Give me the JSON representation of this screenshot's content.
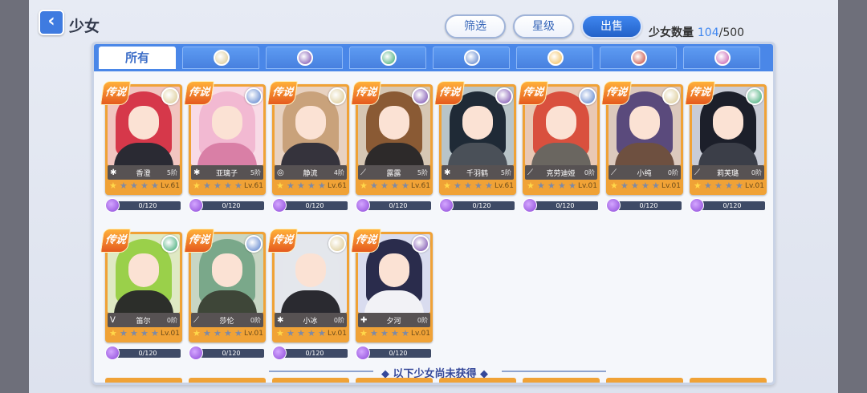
{
  "header": {
    "back_icon": "chevron-left-icon",
    "title": "少女",
    "filter_label": "筛选",
    "star_label": "星级",
    "sell_label": "出售",
    "count_label": "少女数量",
    "count_current": "104",
    "count_max": "/500"
  },
  "tabs": [
    {
      "label": "所有",
      "icon": "",
      "active": true
    },
    {
      "label": "",
      "icon": "gold-emblem-icon",
      "color": "#d8c58a"
    },
    {
      "label": "",
      "icon": "purple-emblem-icon",
      "color": "#6e3fa8"
    },
    {
      "label": "",
      "icon": "green-emblem-icon",
      "color": "#2fa36a"
    },
    {
      "label": "",
      "icon": "blue-gold-emblem-icon",
      "color": "#4d78c8"
    },
    {
      "label": "",
      "icon": "sun-emblem-icon",
      "color": "#f0b84a"
    },
    {
      "label": "",
      "icon": "red-emblem-icon",
      "color": "#c0392b"
    },
    {
      "label": "",
      "icon": "pink-emblem-icon",
      "color": "#c24fa8"
    }
  ],
  "badge_text": "传说",
  "cards": [
    {
      "name": "香澄",
      "tier": "5阶",
      "level": "Lv.61",
      "stars": 1,
      "frag": "0/120",
      "cls": "✱",
      "elem": "#d8c58a",
      "hair": "#d6384a",
      "outfit": "#2a2a33",
      "bg": "#f1c5c0"
    },
    {
      "name": "亚璃子",
      "tier": "5阶",
      "level": "Lv.61",
      "stars": 1,
      "frag": "0/120",
      "cls": "✱",
      "elem": "#4d78c8",
      "hair": "#f2b9d2",
      "outfit": "#d97fa6",
      "bg": "#f8dbe6"
    },
    {
      "name": "静流",
      "tier": "4阶",
      "level": "Lv.61",
      "stars": 1,
      "frag": "0/120",
      "cls": "◎",
      "elem": "#d8c58a",
      "hair": "#c9a27b",
      "outfit": "#35333c",
      "bg": "#e8d2c1"
    },
    {
      "name": "露露",
      "tier": "5阶",
      "level": "Lv.61",
      "stars": 1,
      "frag": "0/120",
      "cls": "⟋",
      "elem": "#6e3fa8",
      "hair": "#8a5a34",
      "outfit": "#2d2a2a",
      "bg": "#d6c7b4"
    },
    {
      "name": "千羽鹤",
      "tier": "5阶",
      "level": "Lv.61",
      "stars": 1,
      "frag": "0/120",
      "cls": "✱",
      "elem": "#6e3fa8",
      "hair": "#1f2a36",
      "outfit": "#4a5058",
      "bg": "#b8c4c8"
    },
    {
      "name": "克劳迪娅",
      "tier": "0阶",
      "level": "Lv.01",
      "stars": 1,
      "frag": "0/120",
      "cls": "⟋",
      "elem": "#4d78c8",
      "hair": "#d9503e",
      "outfit": "#6a6660",
      "bg": "#e9c8b4"
    },
    {
      "name": "小纯",
      "tier": "0阶",
      "level": "Lv.01",
      "stars": 1,
      "frag": "0/120",
      "cls": "⟋",
      "elem": "#d8c58a",
      "hair": "#5a4a7c",
      "outfit": "#6e5040",
      "bg": "#dcc9bd"
    },
    {
      "name": "莉芙璐",
      "tier": "0阶",
      "level": "Lv.01",
      "stars": 1,
      "frag": "0/120",
      "cls": "⟋",
      "elem": "#2fa36a",
      "hair": "#1c1f2a",
      "outfit": "#3b3e48",
      "bg": "#c9ccd6"
    },
    {
      "name": "笛尔",
      "tier": "0阶",
      "level": "Lv.01",
      "stars": 1,
      "frag": "0/120",
      "cls": "ᐯ",
      "elem": "#2fa36a",
      "hair": "#9ad04a",
      "outfit": "#2c2e2a",
      "bg": "#dfe9c4"
    },
    {
      "name": "莎伦",
      "tier": "0阶",
      "level": "Lv.01",
      "stars": 1,
      "frag": "0/120",
      "cls": "⟋",
      "elem": "#4d78c8",
      "hair": "#7aa88a",
      "outfit": "#3e4638",
      "bg": "#c8d6c4"
    },
    {
      "name": "小冰",
      "tier": "0阶",
      "level": "Lv.01",
      "stars": 1,
      "frag": "0/120",
      "cls": "✱",
      "elem": "#d8c58a",
      "hair": "#e4e7ec",
      "outfit": "#2a2a30",
      "bg": "#e4e6ec"
    },
    {
      "name": "夕河",
      "tier": "0阶",
      "level": "Lv.01",
      "stars": 1,
      "frag": "0/120",
      "cls": "✚",
      "elem": "#6e3fa8",
      "hair": "#2a2c4c",
      "outfit": "#f2f2f6",
      "bg": "#d9dcef"
    }
  ],
  "divider_text": "◆ 以下少女尚未获得 ◆",
  "colors": {
    "accent": "#3f86ef",
    "card_frame": "#f0a236",
    "panel_bar": "#4a87e8"
  }
}
